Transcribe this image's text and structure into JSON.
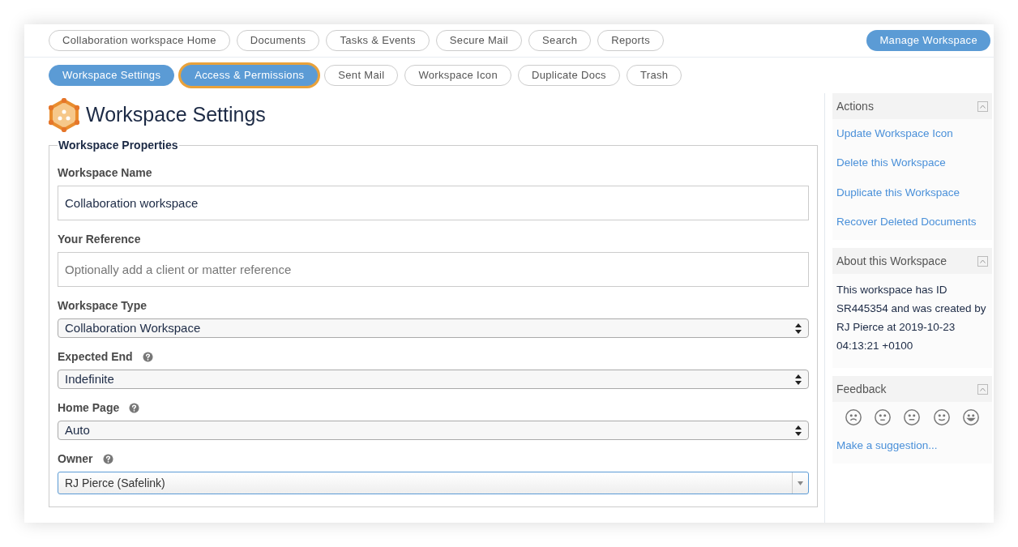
{
  "top_nav": [
    {
      "label": "Collaboration workspace Home",
      "selected": false
    },
    {
      "label": "Documents",
      "selected": false
    },
    {
      "label": "Tasks & Events",
      "selected": false
    },
    {
      "label": "Secure Mail",
      "selected": false
    },
    {
      "label": "Search",
      "selected": false
    },
    {
      "label": "Reports",
      "selected": false
    }
  ],
  "manage_button": "Manage Workspace",
  "sub_nav": [
    {
      "label": "Workspace Settings",
      "selected": true,
      "focused": false
    },
    {
      "label": "Access & Permissions",
      "selected": true,
      "focused": true
    },
    {
      "label": "Sent Mail",
      "selected": false,
      "focused": false
    },
    {
      "label": "Workspace Icon",
      "selected": false,
      "focused": false
    },
    {
      "label": "Duplicate Docs",
      "selected": false,
      "focused": false
    },
    {
      "label": "Trash",
      "selected": false,
      "focused": false
    }
  ],
  "page_title": "Workspace Settings",
  "fieldset": {
    "legend": "Workspace Properties",
    "fields": [
      {
        "label": "Workspace Name",
        "kind": "text",
        "help": false,
        "value": "Collaboration workspace"
      },
      {
        "label": "Your Reference",
        "kind": "text",
        "help": false,
        "placeholder": "Optionally add a client or matter reference"
      },
      {
        "label": "Workspace Type",
        "kind": "select",
        "help": false,
        "value": "Collaboration Workspace"
      },
      {
        "label": "Expected End",
        "kind": "select",
        "help": true,
        "value": "Indefinite"
      },
      {
        "label": "Home Page",
        "kind": "select",
        "help": true,
        "value": "Auto"
      },
      {
        "label": "Owner",
        "kind": "combo",
        "help": true,
        "value": "RJ Pierce (Safelink)"
      }
    ]
  },
  "sidebar": [
    {
      "title": "Actions",
      "kind": "links",
      "links": [
        "Update Workspace Icon",
        "Delete this Workspace",
        "Duplicate this Workspace",
        "Recover Deleted Documents"
      ]
    },
    {
      "title": "About this Workspace",
      "kind": "text",
      "text": "This workspace has ID SR445354 and was created by RJ Pierce at 2019-10-23 04:13:21 +0100"
    },
    {
      "title": "Feedback",
      "kind": "feedback",
      "links": [
        "Make a suggestion..."
      ]
    }
  ]
}
